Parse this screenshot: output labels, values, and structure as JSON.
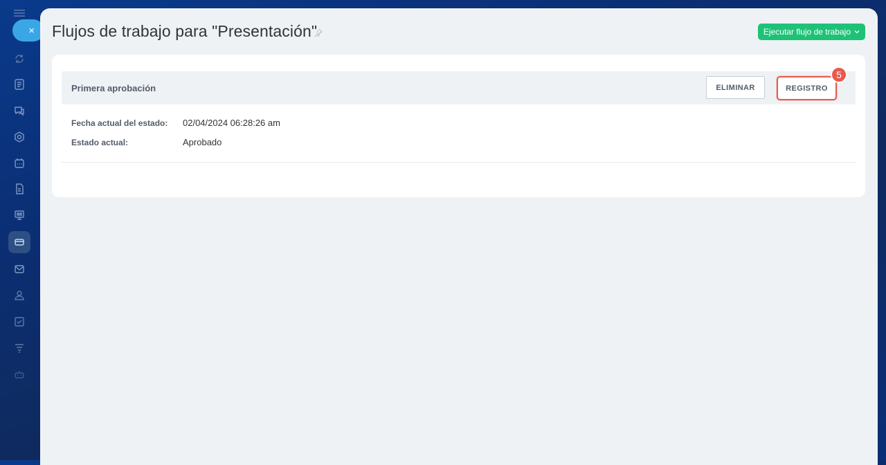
{
  "sidebar": {
    "close_symbol": "×",
    "icons": [
      "refresh-icon",
      "news-icon",
      "chat-icon",
      "hexagon-icon",
      "calendar-icon",
      "document-icon",
      "presentation-icon",
      "crm-icon",
      "mail-icon",
      "contacts-icon",
      "tasks-icon",
      "filter-icon",
      "robot-icon"
    ]
  },
  "header": {
    "title": "Flujos de trabajo para \"Presentación\"",
    "run_button_label": "Ejecutar flujo de trabajo"
  },
  "workflow": {
    "name": "Primera aprobación",
    "delete_label": "ELIMINAR",
    "log_label": "REGISTRO",
    "step_badge": "5",
    "fields": [
      {
        "label": "Fecha actual del estado:",
        "value": "02/04/2024 06:28:26 am"
      },
      {
        "label": "Estado actual:",
        "value": "Aprobado"
      }
    ]
  },
  "colors": {
    "accent_green": "#1ec277",
    "highlight_red": "#e85b4c",
    "close_blue": "#3aa6e6"
  }
}
